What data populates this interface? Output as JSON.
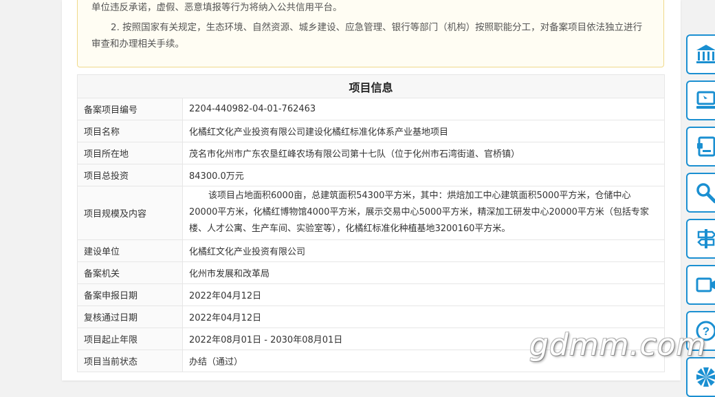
{
  "notice": {
    "line1": "单位违反承诺，虚假、恶意填报等行为将纳入公共信用平台。",
    "line2": "2. 按照国家有关规定，生态环境、自然资源、城乡建设、应急管理、银行等部门（机构）按照职能分工，对备案项目依法独立进行审查和办理相关手续。"
  },
  "project_info": {
    "title": "项目信息",
    "rows": [
      {
        "label": "备案项目编号",
        "value": "2204-440982-04-01-762463"
      },
      {
        "label": "项目名称",
        "value": "化橘红文化产业投资有限公司建设化橘红标准化体系产业基地项目"
      },
      {
        "label": "项目所在地",
        "value": "茂名市化州市广东农垦红峰农场有限公司第十七队（位于化州市石湾街道、官桥镇）"
      },
      {
        "label": "项目总投资",
        "value": "84300.0万元"
      },
      {
        "label": "项目规模及内容",
        "value": "该项目占地面积6000亩，总建筑面积54300平方米，其中：烘焙加工中心建筑面积5000平方米，仓储中心20000平方米，化橘红博物馆4000平方米，展示交易中心5000平方米，精深加工研发中心20000平方米（包括专家楼、人才公寓、生产车间、实验室等），化橘红标准化种植基地3200160平方米。"
      },
      {
        "label": "建设单位",
        "value": "化橘红文化产业投资有限公司"
      },
      {
        "label": "备案机关",
        "value": "化州市发展和改革局"
      },
      {
        "label": "备案申报日期",
        "value": "2022年04月12日"
      },
      {
        "label": "复核通过日期",
        "value": "2022年04月12日"
      },
      {
        "label": "项目起止年限",
        "value": "2022年08月01日 - 2030年08月01日"
      },
      {
        "label": "项目当前状态",
        "value": "办结（通过）"
      }
    ]
  },
  "sidebar": {
    "icons": [
      "government-icon",
      "computer-icon",
      "document-icon",
      "search-icon",
      "signpost-icon",
      "video-icon",
      "help-icon",
      "pinwheel-icon"
    ]
  },
  "colors": {
    "accent": "#1a8fd1",
    "notice_border": "#f0d98a"
  },
  "watermark": "gdmm.com"
}
